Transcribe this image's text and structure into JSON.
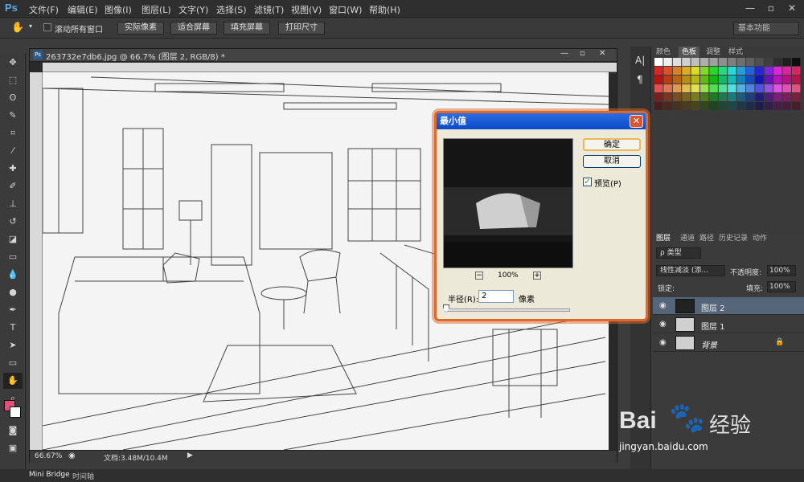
{
  "app": {
    "logo": "Ps"
  },
  "menu": [
    "文件(F)",
    "编辑(E)",
    "图像(I)",
    "图层(L)",
    "文字(Y)",
    "选择(S)",
    "滤镜(T)",
    "视图(V)",
    "窗口(W)",
    "帮助(H)"
  ],
  "options": {
    "scroll_all_label": "滚动所有窗口",
    "btn1": "实际像素",
    "btn2": "适合屏幕",
    "btn3": "填充屏幕",
    "btn4": "打印尺寸",
    "workspace": "基本功能"
  },
  "document": {
    "tab_title": "263732e7db6.jpg @ 66.7% (图层 2, RGB/8) *",
    "zoom": "66.67%",
    "doc_size": "文档:3.48M/10.4M"
  },
  "panels": {
    "color_tabs": [
      "颜色",
      "色板",
      "调整",
      "样式"
    ],
    "layer_tabs": [
      "图层",
      "通道",
      "路径",
      "历史记录",
      "动作"
    ],
    "kind": "ρ 类型",
    "blend": "线性减淡 (添...",
    "opacity_label": "不透明度:",
    "opacity": "100%",
    "lock_label": "锁定:",
    "fill_label": "填充:",
    "fill": "100%"
  },
  "layers": [
    {
      "name": "图层 2",
      "selected": true
    },
    {
      "name": "图层 1",
      "selected": false
    },
    {
      "name": "背景",
      "selected": false,
      "italic": true
    }
  ],
  "dialog": {
    "title": "最小值",
    "ok": "确定",
    "cancel": "取消",
    "preview_label": "预览(P)",
    "zoom": "100%",
    "radius_label": "半径(R):",
    "radius_value": "2",
    "unit": "像素"
  },
  "bottom_tabs": [
    "Mini Bridge",
    "时间轴"
  ],
  "watermark": {
    "brand": "Bai",
    "brand2": "经验",
    "url": "jingyan.baidu.com"
  },
  "colors": {
    "accent": "#e0692a",
    "foreground": "#e0507a",
    "background": "#ffffff",
    "title_blue": "#0a4ac8"
  }
}
